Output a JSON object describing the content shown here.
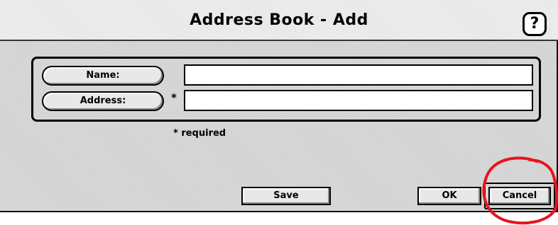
{
  "dialog": {
    "title": "Address Book - Add",
    "help_label": "?"
  },
  "fields": {
    "name_label": "Name:",
    "name_value": "",
    "address_label": "Address:",
    "address_value": "",
    "required_marker": "*"
  },
  "required_note": "* required",
  "buttons": {
    "save_label": "Save",
    "ok_label": "OK",
    "cancel_label": "Cancel"
  },
  "colors": {
    "dialog_bg": "#d2d2d2",
    "annotation": "#e8141e"
  }
}
